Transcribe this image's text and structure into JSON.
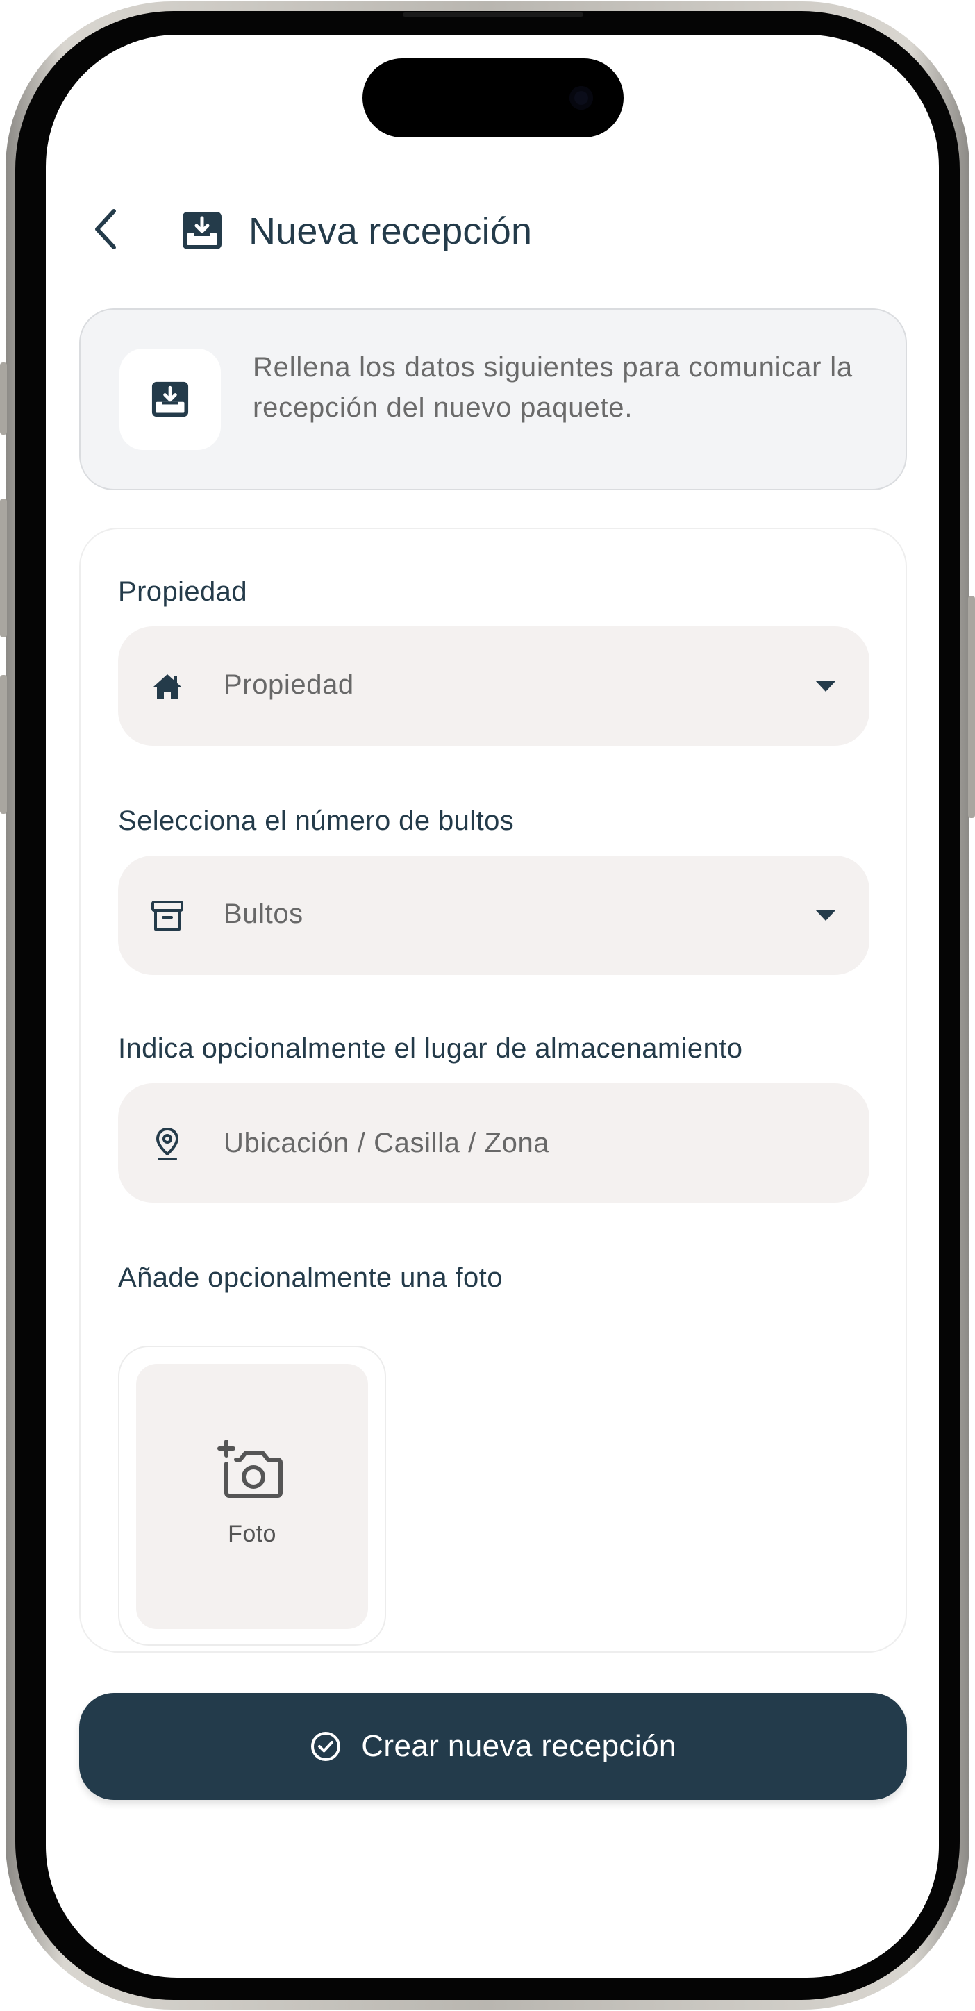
{
  "header": {
    "title": "Nueva recepción",
    "back_icon": "chevron-left-icon",
    "title_icon": "inbox-download-icon"
  },
  "info": {
    "text": "Rellena los datos siguientes para comunicar la recepción del nuevo paquete.",
    "icon": "inbox-download-icon"
  },
  "form": {
    "property": {
      "label": "Propiedad",
      "placeholder": "Propiedad",
      "icon": "house-icon"
    },
    "packages": {
      "label": "Selecciona el número de bultos",
      "placeholder": "Bultos",
      "icon": "archive-box-icon"
    },
    "location": {
      "label": "Indica opcionalmente el lugar de almacenamiento",
      "placeholder": "Ubicación / Casilla / Zona",
      "value": "",
      "icon": "location-pin-icon"
    },
    "photo": {
      "label": "Añade opcionalmente una foto",
      "button_label": "Foto",
      "icon": "add-camera-icon"
    }
  },
  "submit": {
    "label": "Crear nueva recepción",
    "icon": "check-circle-icon"
  },
  "colors": {
    "primary": "#233b4b",
    "field_bg": "#f4f1f0",
    "info_bg": "#f3f4f6"
  }
}
